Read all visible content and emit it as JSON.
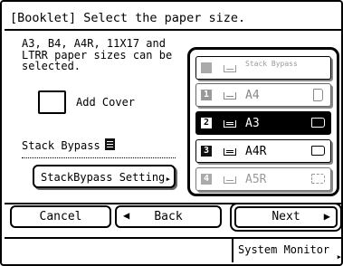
{
  "header": {
    "title": "[Booklet] Select the paper size."
  },
  "message": {
    "line1": "A3, B4, A4R, 11X17 and",
    "line2": "LTRR paper sizes can be",
    "line3": "selected."
  },
  "cover": {
    "label": "Add Cover",
    "checked": false
  },
  "stack_bypass": {
    "label": "Stack Bypass",
    "icon": "bypass-tray-icon",
    "settings_label": "StackBypass Setting"
  },
  "paper_sources": [
    {
      "num": "1",
      "size": "Stack Bypass",
      "orientation": "none",
      "state": "faint"
    },
    {
      "num": "1",
      "size": "A4",
      "orientation": "portrait",
      "state": "dim"
    },
    {
      "num": "2",
      "size": "A3",
      "orientation": "landscape",
      "state": "selected"
    },
    {
      "num": "3",
      "size": "A4R",
      "orientation": "landscape",
      "state": "normal"
    },
    {
      "num": "4",
      "size": "A5R",
      "orientation": "landscape",
      "state": "faint"
    }
  ],
  "nav": {
    "cancel_label": "Cancel",
    "back_label": "Back",
    "next_label": "Next"
  },
  "footer": {
    "system_monitor_label": "System Monitor"
  }
}
